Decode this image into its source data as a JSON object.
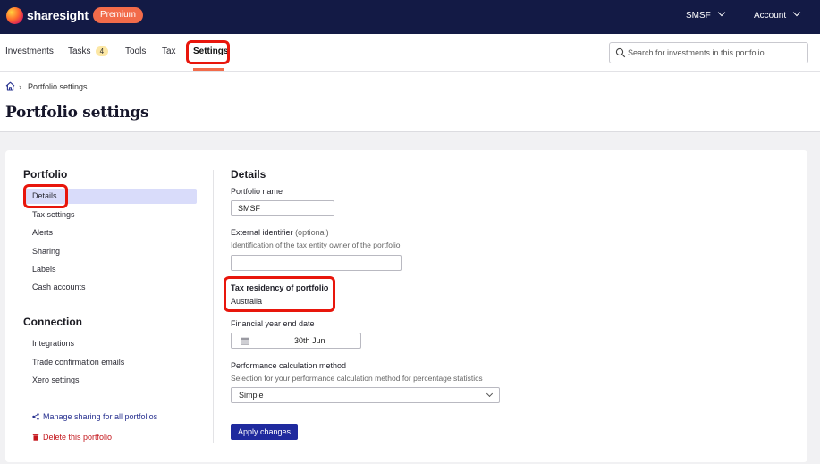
{
  "topbar": {
    "brand": "sharesight",
    "plan_badge": "Premium",
    "portfolio_menu": "SMSF",
    "account_menu": "Account"
  },
  "nav": {
    "tabs": [
      {
        "label": "Investments"
      },
      {
        "label": "Tasks",
        "badge": "4"
      },
      {
        "label": "Tools"
      },
      {
        "label": "Tax"
      },
      {
        "label": "Settings",
        "active": true
      }
    ],
    "search_placeholder": "Search for investments in this portfolio"
  },
  "breadcrumb": {
    "current": "Portfolio settings"
  },
  "page_title": "Portfolio settings",
  "sidebar": {
    "portfolio_heading": "Portfolio",
    "portfolio_items": [
      "Details",
      "Tax settings",
      "Alerts",
      "Sharing",
      "Labels",
      "Cash accounts"
    ],
    "connection_heading": "Connection",
    "connection_items": [
      "Integrations",
      "Trade confirmation emails",
      "Xero settings"
    ],
    "manage_sharing": "Manage sharing for all portfolios",
    "delete_portfolio": "Delete this portfolio"
  },
  "details": {
    "title": "Details",
    "portfolio_name_label": "Portfolio name",
    "portfolio_name_value": "SMSF",
    "external_id_label": "External identifier",
    "external_id_optional": "(optional)",
    "external_id_helper": "Identification of the tax entity owner of the portfolio",
    "external_id_value": "",
    "tax_residency_label": "Tax residency of portfolio",
    "tax_residency_value": "Australia",
    "fy_end_label": "Financial year end date",
    "fy_end_value": "30th Jun",
    "perf_method_label": "Performance calculation method",
    "perf_method_helper": "Selection for your performance calculation method for percentage statistics",
    "perf_method_value": "Simple",
    "apply_button": "Apply changes"
  },
  "colors": {
    "topbar_bg": "#131a45",
    "accent_orange": "#f26b4a",
    "primary_button": "#1f2a9e",
    "active_sidebar": "#d9dcfa",
    "highlight_red": "#e8160c",
    "danger": "#c4161c"
  }
}
